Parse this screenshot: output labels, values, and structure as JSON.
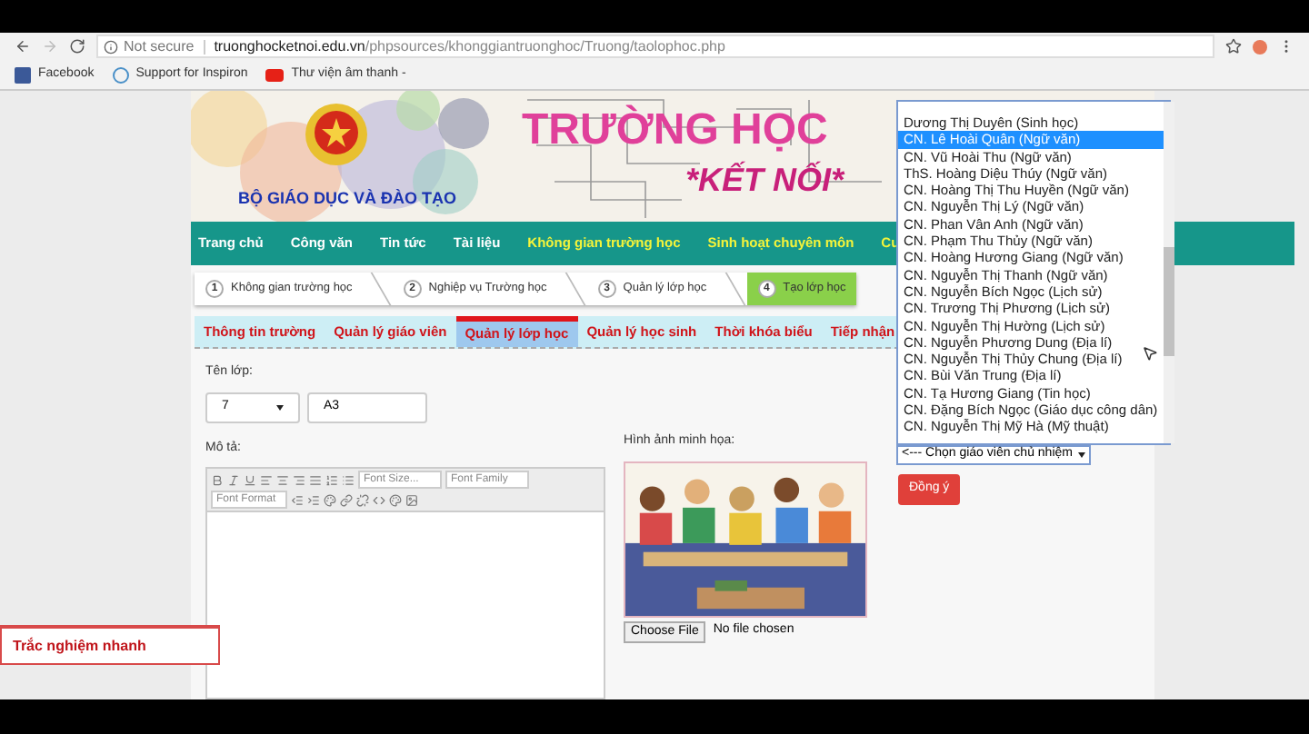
{
  "browser": {
    "security": "Not secure",
    "url_host": "truonghocketnoi.edu.vn",
    "url_path": "/phpsources/khonggiantruonghoc/Truong/taolophoc.php",
    "bookmarks": [
      {
        "label": "Facebook",
        "kind": "facebook"
      },
      {
        "label": "Support for Inspiron",
        "kind": "dell"
      },
      {
        "label": "Thư viện âm thanh -",
        "kind": "youtube"
      }
    ]
  },
  "banner": {
    "ministry": "BỘ GIÁO DỤC VÀ ĐÀO TẠO",
    "title": "TRƯỜNG HỌC",
    "subtitle": "*KẾT NỐI*"
  },
  "nav": [
    {
      "label": "Trang chủ",
      "highlight": false
    },
    {
      "label": "Công văn",
      "highlight": false
    },
    {
      "label": "Tin tức",
      "highlight": false
    },
    {
      "label": "Tài liệu",
      "highlight": false
    },
    {
      "label": "Không gian trường học",
      "highlight": true
    },
    {
      "label": "Sinh hoạt chuyên môn",
      "highlight": true
    },
    {
      "label": "Cu",
      "highlight": true
    }
  ],
  "steps": [
    {
      "number": "1",
      "label": "Không gian trường học",
      "selected": false
    },
    {
      "number": "2",
      "label": "Nghiệp vụ Trường học",
      "selected": false
    },
    {
      "number": "3",
      "label": "Quản lý lớp học",
      "selected": false
    },
    {
      "number": "4",
      "label": "Tạo lớp học",
      "selected": true
    }
  ],
  "tabs": [
    {
      "label": "Thông tin trường",
      "selected": false
    },
    {
      "label": "Quản lý giáo viên",
      "selected": false
    },
    {
      "label": "Quản lý lớp học",
      "selected": true
    },
    {
      "label": "Quản lý học sinh",
      "selected": false
    },
    {
      "label": "Thời khóa biểu",
      "selected": false
    },
    {
      "label": "Tiếp nhận",
      "selected": false
    }
  ],
  "form": {
    "class_label": "Tên lớp:",
    "grade": "7",
    "class_name": "A3",
    "description_label": "Mô tả:",
    "font_size": "Font Size...",
    "font_family": "Font Family",
    "font_format": "Font Format",
    "image_label": "Hình ảnh minh họa:",
    "file_button": "Choose File",
    "file_status": "No file chosen"
  },
  "teacher_select": {
    "value": "<--- Chọn giáo viên chủ nhiệm",
    "options": [
      {
        "label": "Dương Thị Duyên (Sinh học)",
        "selected": false
      },
      {
        "label": "CN. Lê Hoài Quân (Ngữ văn)",
        "selected": true
      },
      {
        "label": "CN. Vũ Hoài Thu (Ngữ văn)",
        "selected": false
      },
      {
        "label": "ThS. Hoàng Diệu Thúy (Ngữ văn)",
        "selected": false
      },
      {
        "label": "CN. Hoàng Thị Thu Huyền (Ngữ văn)",
        "selected": false
      },
      {
        "label": "CN. Nguyễn Thị Lý (Ngữ văn)",
        "selected": false
      },
      {
        "label": "CN. Phan Vân Anh (Ngữ văn)",
        "selected": false
      },
      {
        "label": "CN. Phạm Thu Thủy (Ngữ văn)",
        "selected": false
      },
      {
        "label": "CN. Hoàng Hương Giang (Ngữ văn)",
        "selected": false
      },
      {
        "label": "CN. Nguyễn Thị Thanh (Ngữ văn)",
        "selected": false
      },
      {
        "label": "CN. Nguyễn Bích Ngọc (Lịch sử)",
        "selected": false
      },
      {
        "label": "CN. Trương Thị Phương (Lịch sử)",
        "selected": false
      },
      {
        "label": "CN. Nguyễn Thị Hường (Lịch sử)",
        "selected": false
      },
      {
        "label": "CN. Nguyễn Phương Dung (Địa lí)",
        "selected": false
      },
      {
        "label": "CN. Nguyễn Thị Thủy Chung (Địa lí)",
        "selected": false
      },
      {
        "label": "CN. Bùi Văn Trung (Địa lí)",
        "selected": false
      },
      {
        "label": "CN. Tạ Hương Giang (Tin học)",
        "selected": false
      },
      {
        "label": "CN. Đặng Bích Ngọc (Giáo dục công dân)",
        "selected": false
      },
      {
        "label": "CN. Nguyễn Thị Mỹ Hà (Mỹ thuật)",
        "selected": false
      }
    ]
  },
  "confirm_button": "Đồng ý",
  "quiz_button": "Trắc nghiệm nhanh"
}
